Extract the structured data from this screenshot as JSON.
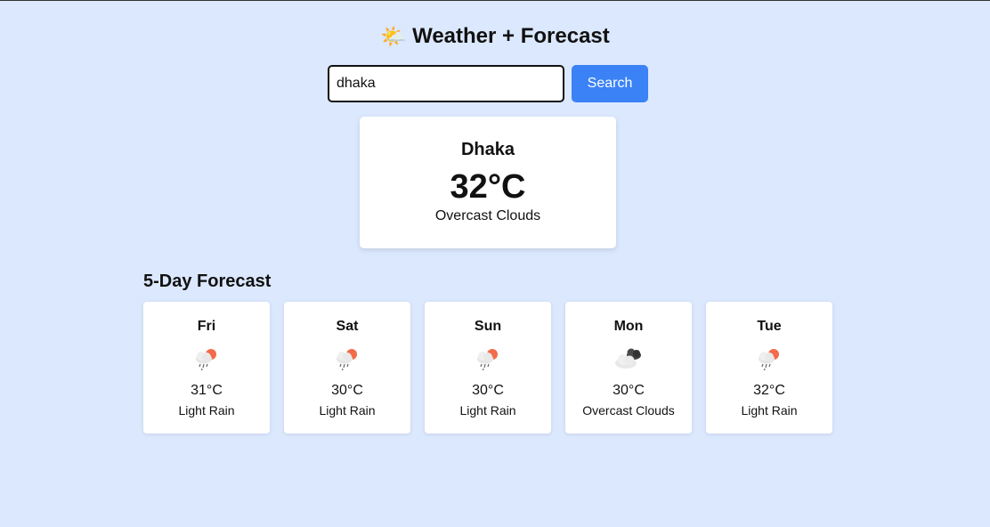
{
  "app": {
    "title_emoji": "🌤️",
    "title": "Weather + Forecast"
  },
  "search": {
    "value": "dhaka",
    "placeholder": "",
    "button_label": "Search",
    "button_color": "#3b82f6"
  },
  "current": {
    "city": "Dhaka",
    "temp": "32°C",
    "description": "Overcast Clouds"
  },
  "forecast": {
    "heading": "5-Day Forecast",
    "days": [
      {
        "day": "Fri",
        "icon": "light-rain-icon",
        "temp": "31°C",
        "description": "Light Rain"
      },
      {
        "day": "Sat",
        "icon": "light-rain-icon",
        "temp": "30°C",
        "description": "Light Rain"
      },
      {
        "day": "Sun",
        "icon": "light-rain-icon",
        "temp": "30°C",
        "description": "Light Rain"
      },
      {
        "day": "Mon",
        "icon": "overcast-clouds-icon",
        "temp": "30°C",
        "description": "Overcast Clouds"
      },
      {
        "day": "Tue",
        "icon": "light-rain-icon",
        "temp": "32°C",
        "description": "Light Rain"
      }
    ]
  },
  "colors": {
    "background": "#dbe8fe",
    "accent": "#3b82f6"
  }
}
